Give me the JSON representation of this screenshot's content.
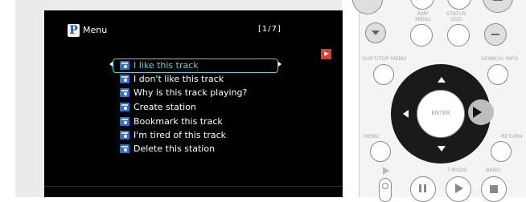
{
  "screen": {
    "menu_title": "Menu",
    "page_indicator": "[1/7]",
    "logo_letter": "P",
    "items": [
      {
        "label": "I like this track",
        "selected": true
      },
      {
        "label": "I don't like this track",
        "selected": false
      },
      {
        "label": "Why is this track playing?",
        "selected": false
      },
      {
        "label": "Create station",
        "selected": false
      },
      {
        "label": "Bookmark this track",
        "selected": false
      },
      {
        "label": "I'm tired of this track",
        "selected": false
      },
      {
        "label": "Delete this station",
        "selected": false
      }
    ],
    "colors": {
      "selection": "#5bd0d2",
      "flag": "#e23b2b",
      "item_icon": "#2f6fd0"
    }
  },
  "remote": {
    "amp_menu_label": "AMP\nMENU",
    "status_osd_label": "STATUS\nOSD",
    "shift_top_menu_label": "SHIFT/TOP MENU",
    "search_info_label": "SEARCH/ INFO",
    "enter_label": "ENTER",
    "menu_label": "MENU",
    "return_label": "RETURN",
    "tmode_label": "T.MODE",
    "band_label": "BAND"
  }
}
